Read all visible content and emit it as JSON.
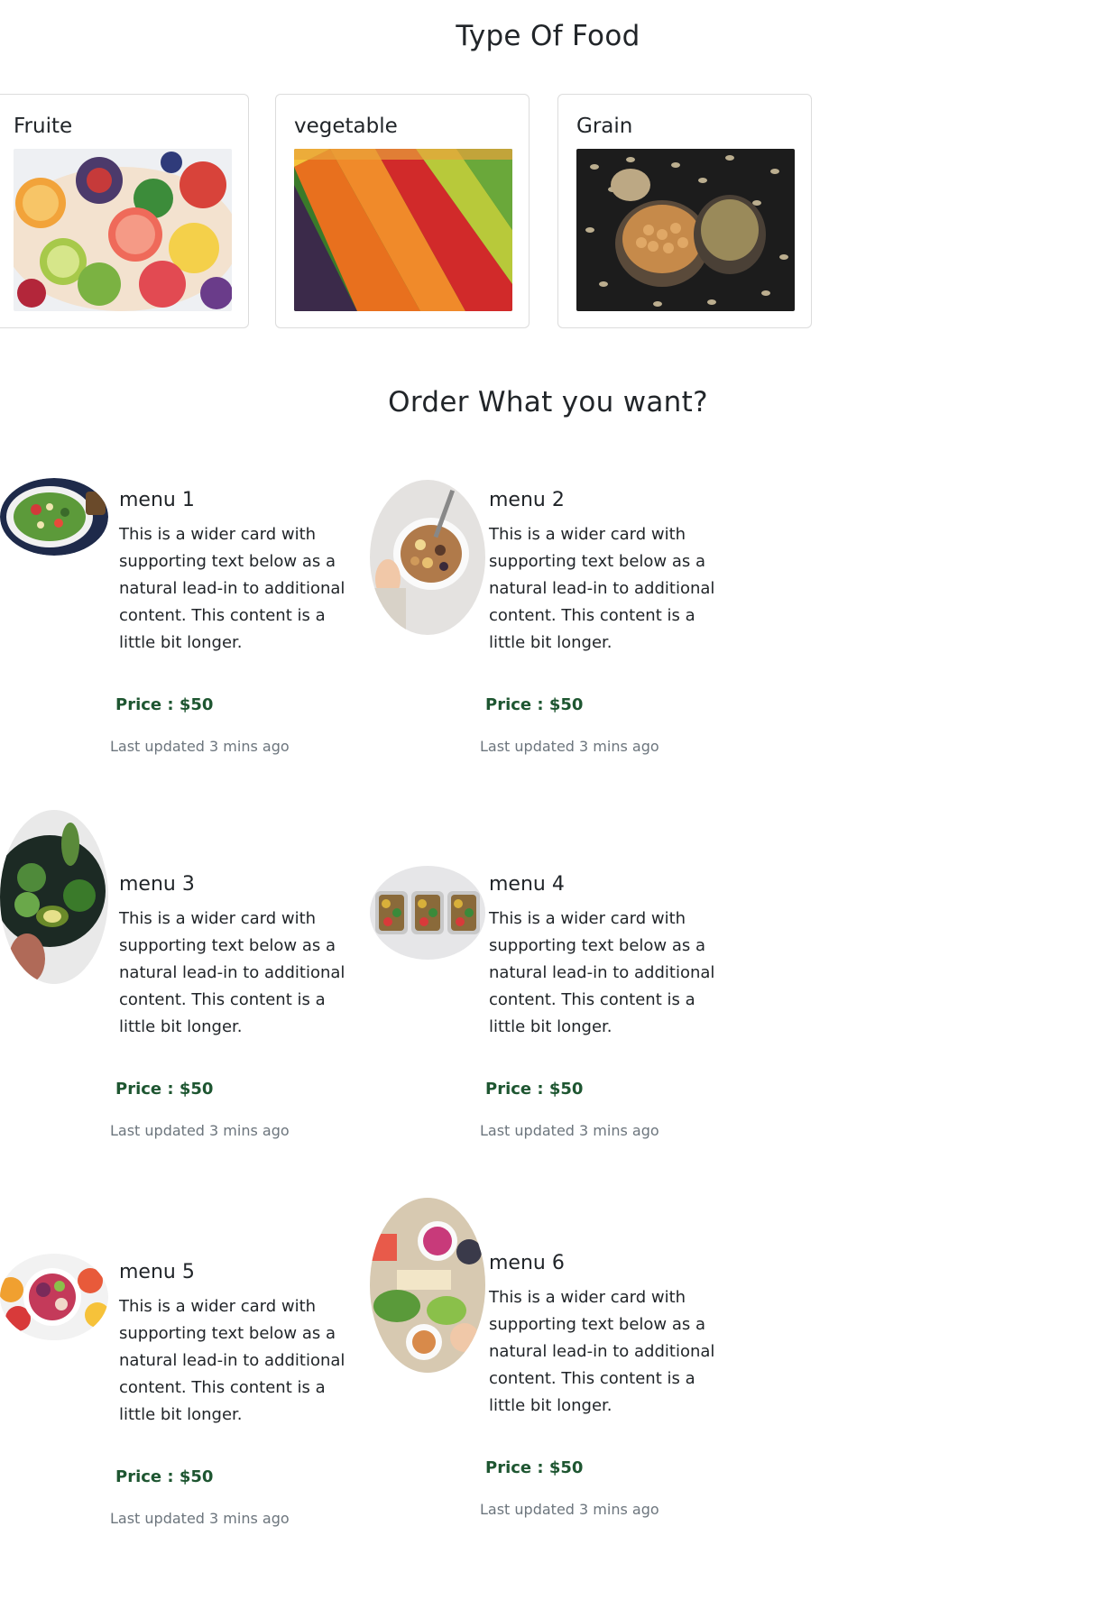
{
  "headings": {
    "types": "Type Of Food",
    "order": "Order What you want?"
  },
  "food_types": [
    {
      "label": "Fruite",
      "image": "fruit-platter-photo"
    },
    {
      "label": "vegetable",
      "image": "vegetable-market-photo"
    },
    {
      "label": "Grain",
      "image": "grain-bowls-photo"
    }
  ],
  "menus": [
    {
      "title": "menu 1",
      "text": "This is a wider card with supporting text below as a natural lead-in to additional content. This content is a little bit longer.",
      "price": "Price : $50",
      "updated": "Last updated 3 mins ago",
      "image": "salad-bowl-photo"
    },
    {
      "title": "menu 2",
      "text": "This is a wider card with supporting text below as a natural lead-in to additional content. This content is a little bit longer.",
      "price": "Price : $50",
      "updated": "Last updated 3 mins ago",
      "image": "granola-bowl-photo"
    },
    {
      "title": "menu 3",
      "text": "This is a wider card with supporting text below as a natural lead-in to additional content. This content is a little bit longer.",
      "price": "Price : $50",
      "updated": "Last updated 3 mins ago",
      "image": "greens-bowl-photo"
    },
    {
      "title": "menu 4",
      "text": "This is a wider card with supporting text below as a natural lead-in to additional content. This content is a little bit longer.",
      "price": "Price : $50",
      "updated": "Last updated 3 mins ago",
      "image": "meal-prep-boxes-photo"
    },
    {
      "title": "menu 5",
      "text": "This is a wider card with supporting text below as a natural lead-in to additional content. This content is a little bit longer.",
      "price": "Price : $50",
      "updated": "Last updated 3 mins ago",
      "image": "fruit-bowl-photo"
    },
    {
      "title": "menu 6",
      "text": "This is a wider card with supporting text below as a natural lead-in to additional content. This content is a little bit longer.",
      "price": "Price : $50",
      "updated": "Last updated 3 mins ago",
      "image": "party-platter-photo"
    }
  ],
  "colors": {
    "price": "#1e5631",
    "muted": "#6c757d",
    "card_border": "#dcdcdc"
  }
}
